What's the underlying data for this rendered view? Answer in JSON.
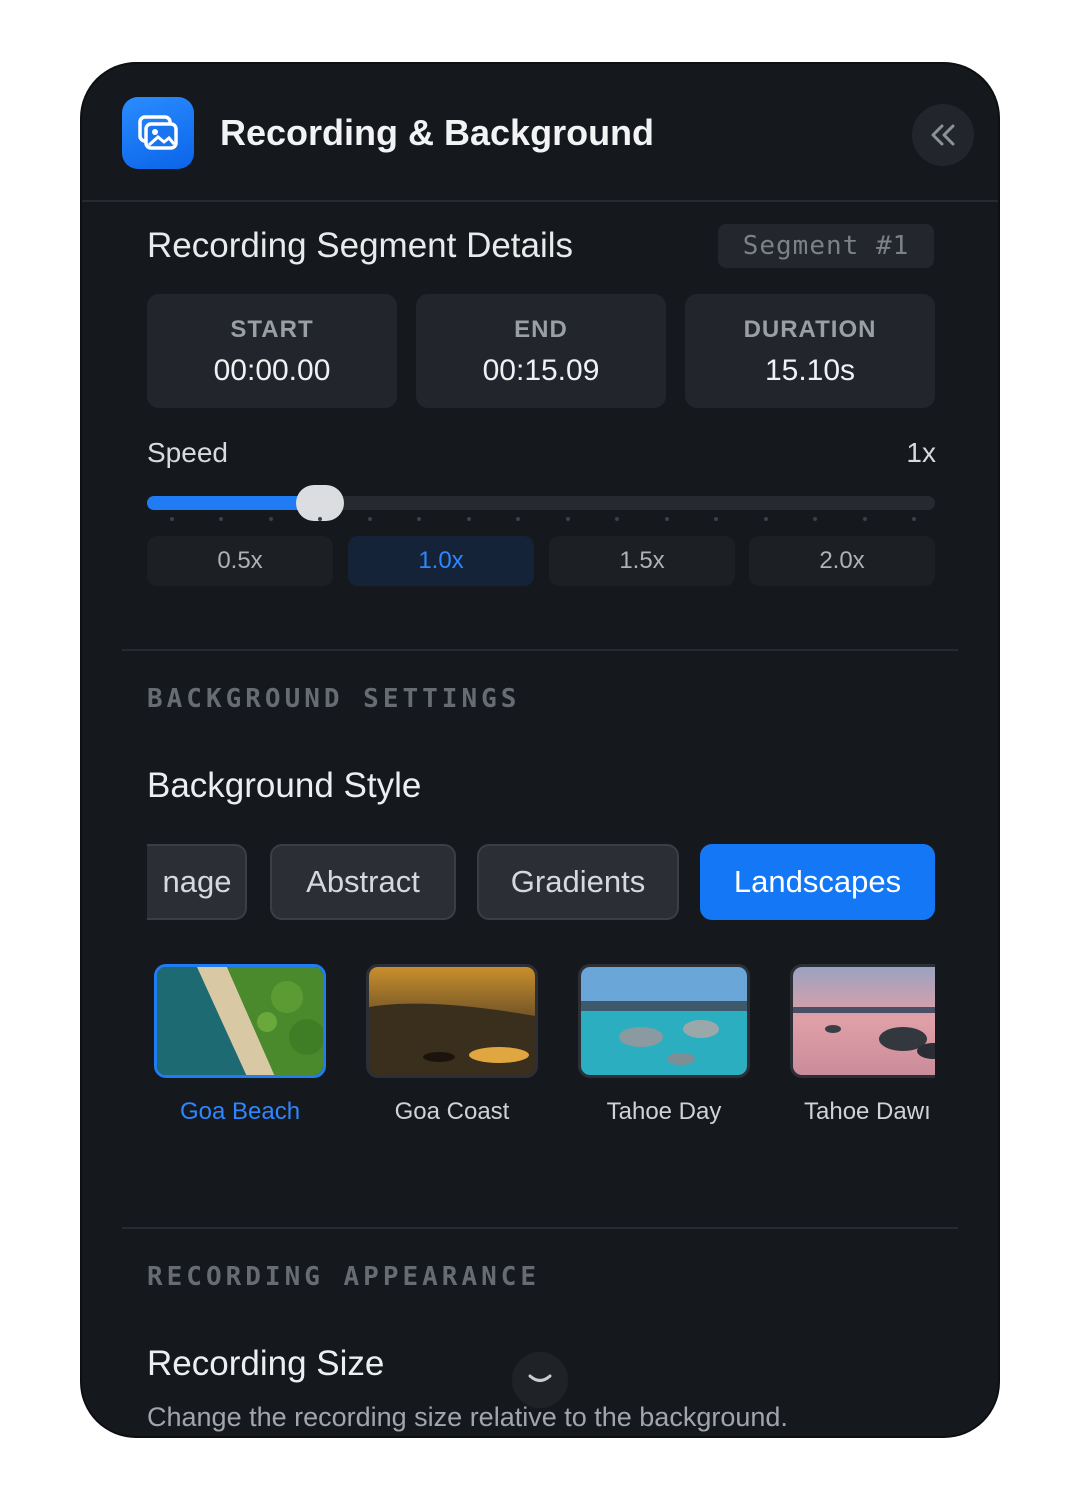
{
  "header": {
    "title": "Recording & Background",
    "app_icon": "gallery-icon",
    "collapse_icon": "double-chevron-left-icon"
  },
  "segment": {
    "title": "Recording Segment Details",
    "badge": "Segment #1",
    "start": {
      "label": "START",
      "value": "00:00.00"
    },
    "end": {
      "label": "END",
      "value": "00:15.09"
    },
    "duration": {
      "label": "DURATION",
      "value": "15.10s"
    }
  },
  "speed": {
    "label": "Speed",
    "value": "1x",
    "slider_fraction": 0.22,
    "presets": [
      {
        "label": "0.5x",
        "active": false
      },
      {
        "label": "1.0x",
        "active": true
      },
      {
        "label": "1.5x",
        "active": false
      },
      {
        "label": "2.0x",
        "active": false
      }
    ]
  },
  "background": {
    "section_label": "BACKGROUND SETTINGS",
    "style_title": "Background Style",
    "tabs": [
      {
        "label": "nage",
        "active": false
      },
      {
        "label": "Abstract",
        "active": false
      },
      {
        "label": "Gradients",
        "active": false
      },
      {
        "label": "Landscapes",
        "active": true
      }
    ],
    "images": [
      {
        "name": "Goa Beach",
        "active": true
      },
      {
        "name": "Goa Coast",
        "active": false
      },
      {
        "name": "Tahoe Day",
        "active": false
      },
      {
        "name": "Tahoe Dawı",
        "active": false
      }
    ]
  },
  "appearance": {
    "section_label": "RECORDING APPEARANCE",
    "size_title": "Recording Size",
    "size_desc": "Change the recording size relative to the background.",
    "scroll_icon": "chevron-down-icon"
  },
  "colors": {
    "accent": "#1477f5",
    "panel": "#15181d",
    "card": "#22262c"
  }
}
